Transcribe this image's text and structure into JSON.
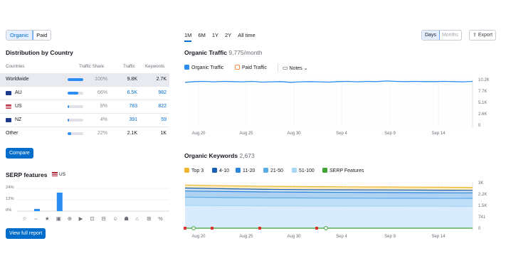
{
  "left": {
    "toggle": [
      "Organic",
      "Paid"
    ],
    "dist_title": "Distribution by Country",
    "columns": [
      "Countries",
      "Traffic Share",
      "Traffic",
      "Keywords"
    ],
    "rows": [
      {
        "name": "Worldwide",
        "share": "100%",
        "share_fill": 1.0,
        "traffic": "9.8K",
        "keywords": "2.7K"
      },
      {
        "name": "AU",
        "share": "66%",
        "share_fill": 0.66,
        "traffic": "6.5K",
        "keywords": "982"
      },
      {
        "name": "US",
        "share": "8%",
        "share_fill": 0.08,
        "traffic": "783",
        "keywords": "822"
      },
      {
        "name": "NZ",
        "share": "4%",
        "share_fill": 0.04,
        "traffic": "391",
        "keywords": "59"
      },
      {
        "name": "Other",
        "share": "22%",
        "share_fill": 0.22,
        "traffic": "2.1K",
        "keywords": "1K"
      }
    ],
    "compare_label": "Compare",
    "serp_title": "SERP features",
    "serp_country": "US",
    "serp_yticks": [
      "24%",
      "12%",
      "0%"
    ],
    "serp_bars": [
      0,
      0.12,
      0,
      0,
      0,
      0,
      0,
      0,
      0,
      0,
      0,
      0,
      0,
      0
    ],
    "serp_bars_tall": [
      0,
      0,
      0,
      1.0,
      0,
      0,
      0,
      0,
      0,
      0,
      0,
      0,
      0,
      0
    ],
    "serp_icons": [
      "☆",
      "⇔",
      "★",
      "▣",
      "⊕",
      "▶",
      "⊡",
      "⊟",
      "☺",
      "☗",
      "⌂",
      "⊞",
      "%"
    ],
    "view_report_label": "View full report"
  },
  "right": {
    "periods": [
      "1M",
      "6M",
      "1Y",
      "2Y",
      "All time"
    ],
    "active_period": "1M",
    "days_toggle": [
      "Days",
      "Months"
    ],
    "export_label": "Export",
    "traffic_title": "Organic Traffic",
    "traffic_sub": "9,775/month",
    "traffic_legend": [
      "Organic Traffic",
      "Paid Traffic",
      "Notes"
    ],
    "traffic_yticks": [
      "10.2K",
      "7.7K",
      "5.1K",
      "2.6K",
      "0"
    ],
    "xticks": [
      "Aug 20",
      "Aug 25",
      "Aug 30",
      "Sep 4",
      "Sep 9",
      "Sep 14"
    ],
    "keywords_title": "Organic Keywords",
    "keywords_sub": "2,673",
    "keywords_legend": [
      "Top 3",
      "4-10",
      "11-20",
      "21-50",
      "51-100",
      "SERP Features"
    ],
    "keywords_yticks": [
      "3K",
      "2.2K",
      "1.5K",
      "741",
      "0"
    ],
    "colors": {
      "accent": "#006dca",
      "traffic_line": "#2b8cf2",
      "paid": "#ff8c43",
      "top3": "#f2b531",
      "k4_10": "#1a5fb4",
      "k11_20": "#2e86de",
      "k21_50": "#5aaee8",
      "k51_100": "#a9d6f5",
      "serp": "#3fa436"
    }
  },
  "chart_data": [
    {
      "type": "line",
      "title": "Organic Traffic",
      "x": [
        "Aug 17",
        "Aug 18",
        "Aug 19",
        "Aug 20",
        "Aug 21",
        "Aug 22",
        "Aug 23",
        "Aug 24",
        "Aug 25",
        "Aug 26",
        "Aug 27",
        "Aug 28",
        "Aug 29",
        "Aug 30",
        "Aug 31",
        "Sep 1",
        "Sep 2",
        "Sep 3",
        "Sep 4",
        "Sep 5",
        "Sep 6",
        "Sep 7",
        "Sep 8",
        "Sep 9",
        "Sep 10",
        "Sep 11",
        "Sep 12",
        "Sep 13",
        "Sep 14",
        "Sep 15",
        "Sep 16"
      ],
      "series": [
        {
          "name": "Organic Traffic",
          "values": [
            9600,
            9750,
            9800,
            9700,
            9800,
            9750,
            9700,
            9800,
            9650,
            9700,
            9750,
            9600,
            9700,
            9750,
            9700,
            9650,
            9750,
            9800,
            9700,
            9800,
            9750,
            9900,
            9800,
            9750,
            9800,
            9750,
            9750,
            9800,
            9750,
            9700,
            9800
          ]
        }
      ],
      "ylim": [
        0,
        10200
      ],
      "yticks": [
        0,
        2600,
        5100,
        7700,
        10200
      ]
    },
    {
      "type": "area",
      "title": "Organic Keywords",
      "x": [
        "Aug 17",
        "Aug 20",
        "Aug 25",
        "Aug 30",
        "Sep 4",
        "Sep 9",
        "Sep 14",
        "Sep 16"
      ],
      "series": [
        {
          "name": "Top 3",
          "values": [
            2850,
            2800,
            2760,
            2740,
            2730,
            2720,
            2700,
            2690
          ]
        },
        {
          "name": "4-10",
          "values": [
            2650,
            2600,
            2560,
            2540,
            2530,
            2520,
            2510,
            2500
          ]
        },
        {
          "name": "11-20",
          "values": [
            2450,
            2420,
            2390,
            2370,
            2360,
            2350,
            2340,
            2330
          ]
        },
        {
          "name": "21-50",
          "values": [
            2050,
            2020,
            2000,
            1990,
            1980,
            1975,
            1970,
            1965
          ]
        },
        {
          "name": "51-100",
          "values": [
            1500,
            1480,
            1470,
            1460,
            1455,
            1450,
            1445,
            1440
          ]
        }
      ],
      "ylim": [
        0,
        3000
      ],
      "yticks": [
        0,
        741,
        1500,
        2200,
        3000
      ]
    }
  ]
}
